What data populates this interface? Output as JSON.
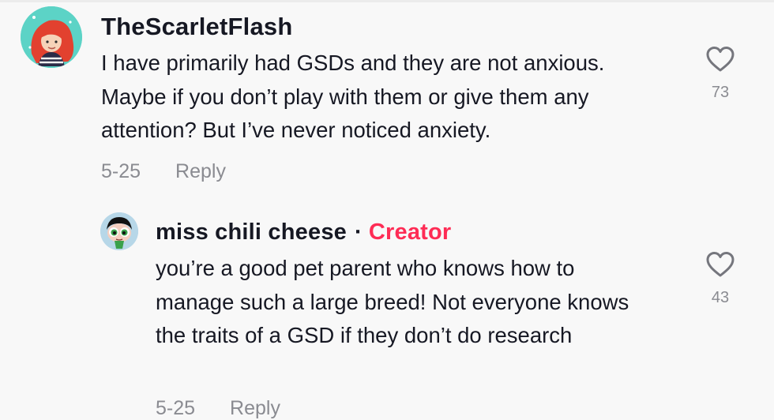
{
  "comments": [
    {
      "username": "TheScarletFlash",
      "text": "I have primarily had GSDs and they are not anxious. Maybe if you don’t play with them or give them any attention? But I’ve never noticed anxiety.",
      "date": "5-25",
      "reply_label": "Reply",
      "likes": "73",
      "avatar_icon": "red-haired-cartoon-avatar"
    }
  ],
  "replies": [
    {
      "username": "miss chili cheese",
      "separator": "·",
      "badge": "Creator",
      "text": "you’re a good pet parent who knows how to manage such a large breed! Not everyone knows the traits of a GSD if they don’t do research",
      "date": "5-25",
      "reply_label": "Reply",
      "likes": "43",
      "avatar_icon": "powerpuff-cartoon-avatar"
    }
  ],
  "colors": {
    "background": "#f8f8f8",
    "primary_text": "#161823",
    "secondary_text": "#8a8b91",
    "creator_badge": "#fe2c55"
  }
}
